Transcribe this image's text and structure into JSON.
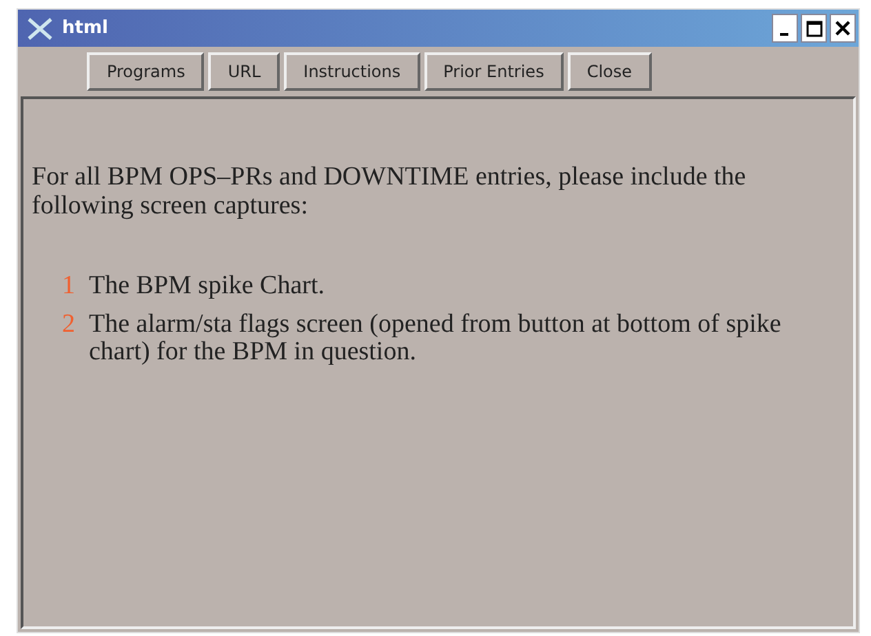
{
  "window": {
    "title": "html"
  },
  "toolbar": {
    "buttons": [
      "Programs",
      "URL",
      "Instructions",
      "Prior Entries",
      "Close"
    ]
  },
  "content": {
    "intro": "For all BPM OPS–PRs and DOWNTIME entries, please include the following screen captures:",
    "items": [
      {
        "number": "1",
        "text": "The BPM spike Chart."
      },
      {
        "number": "2",
        "text": "The alarm/sta flags screen (opened from button at bottom of spike chart) for the BPM in question."
      }
    ]
  }
}
